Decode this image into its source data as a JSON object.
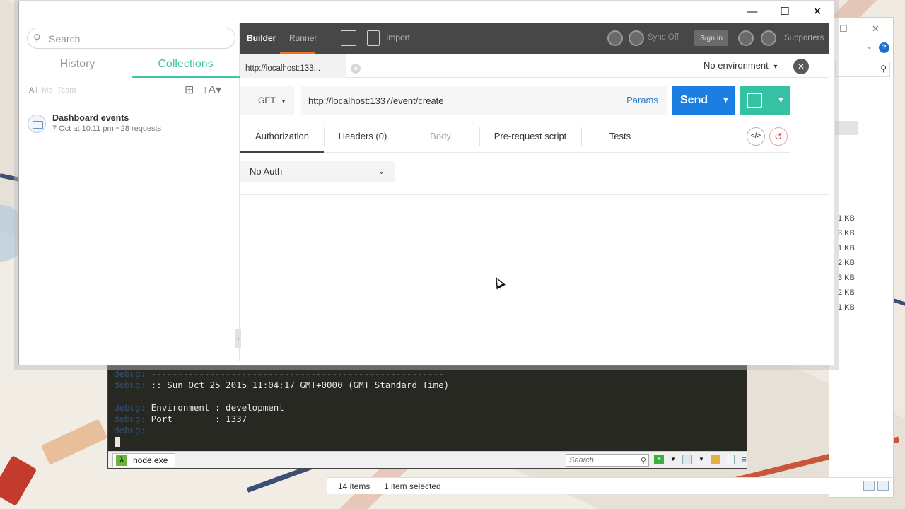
{
  "explorer": {
    "file_sizes": [
      "1 KB",
      "3 KB",
      "1 KB",
      "2 KB",
      "3 KB",
      "2 KB",
      "1 KB"
    ],
    "status_items": "14 items",
    "status_selected": "1 item selected",
    "help_label": "?"
  },
  "console": {
    "lines": [
      {
        "prefix": "debug:",
        "text": " -------------------------------------------------------"
      },
      {
        "prefix": "debug:",
        "text": " :: Sun Oct 25 2015 11:04:17 GMT+0000 (GMT Standard Time)"
      },
      {
        "prefix": "",
        "text": ""
      },
      {
        "prefix": "debug:",
        "text": " Environment : development"
      },
      {
        "prefix": "debug:",
        "text": " Port        : 1337"
      },
      {
        "prefix": "debug:",
        "text": " -------------------------------------------------------"
      }
    ],
    "tab_label": "node.exe",
    "tab_icon": "λ",
    "search_placeholder": "Search"
  },
  "window": {
    "minimize": "—",
    "maximize": "☐",
    "close": "✕"
  },
  "sidebar": {
    "search_placeholder": "Search",
    "tabs": {
      "history": "History",
      "collections": "Collections"
    },
    "filters": {
      "all": "All",
      "me": "Me",
      "team": "Team"
    },
    "collections": [
      {
        "name": "Dashboard events",
        "date": "7 Oct at 10:11 pm",
        "requests": "28 requests"
      }
    ]
  },
  "topbar": {
    "builder": "Builder",
    "runner": "Runner",
    "import": "Import",
    "sync": "Sync Off",
    "signin": "Sign in",
    "supporters": "Supporters"
  },
  "request": {
    "tab_title": "http://localhost:133...",
    "environment": "No environment",
    "method": "GET",
    "url": "http://localhost:1337/event/create",
    "params": "Params",
    "send": "Send",
    "tabs": {
      "authorization": "Authorization",
      "headers": "Headers (0)",
      "body": "Body",
      "prerequest": "Pre-request script",
      "tests": "Tests"
    },
    "auth_type": "No Auth",
    "code_label": "</>",
    "reset_label": "↺"
  },
  "colors": {
    "accent_teal": "#36c2a2",
    "send_blue": "#1a7fe0",
    "runner_underline": "#f47023",
    "topbar": "#474747"
  }
}
